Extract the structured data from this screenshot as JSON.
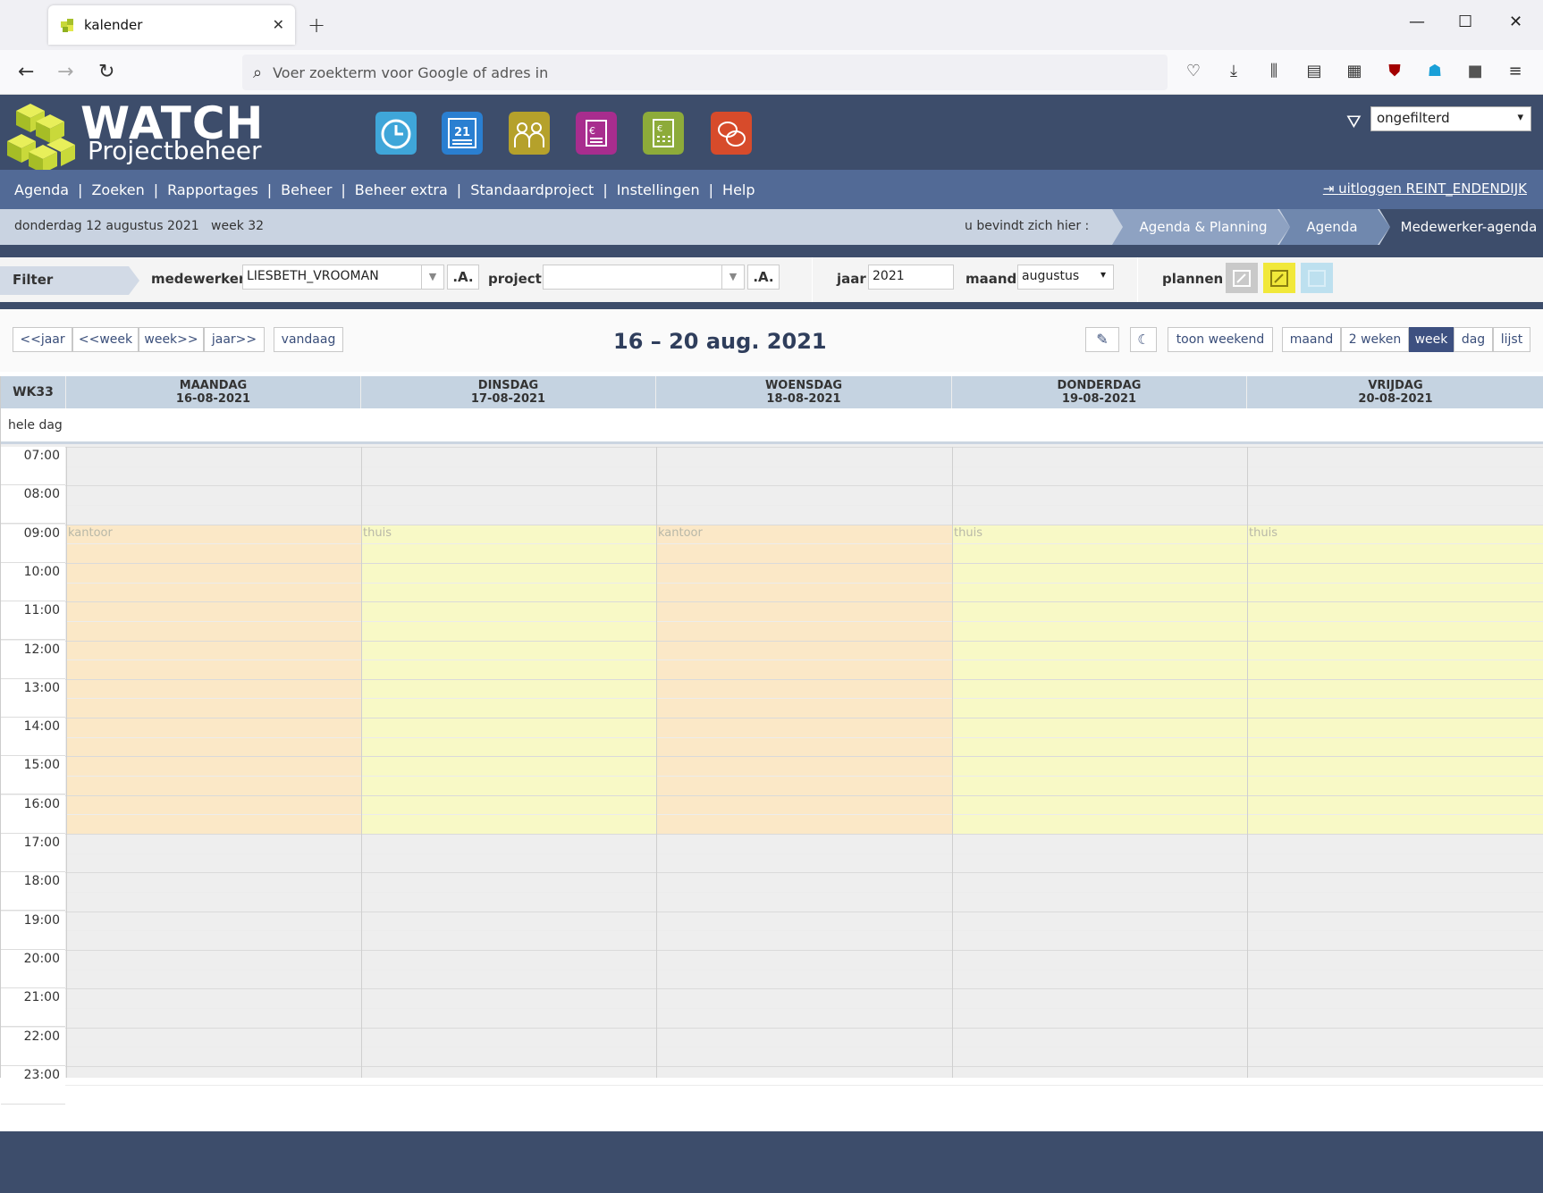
{
  "browser": {
    "tab_title": "kalender",
    "url_placeholder": "Voer zoekterm voor Google of adres in"
  },
  "app": {
    "logo_word": "WATCH",
    "logo_sub": "Projectbeheer",
    "filter_select": "ongefilterd",
    "menu": [
      "Agenda",
      "Zoeken",
      "Rapportages",
      "Beheer",
      "Beheer extra",
      "Standaardproject",
      "Instellingen",
      "Help"
    ],
    "logout": "uitloggen REINT_ENDENDIJK",
    "date": "donderdag 12 augustus 2021",
    "week": "week 32",
    "here_label": "u bevindt zich hier :",
    "crumbs": [
      "Agenda & Planning",
      "Agenda",
      "Medewerker-agenda"
    ]
  },
  "filter": {
    "label": "Filter",
    "employee_label": "medewerker",
    "employee_value": "LIESBETH_VROOMAN",
    "project_label": "project",
    "project_value": "",
    "a_btn": ".A.",
    "year_label": "jaar",
    "year_value": "2021",
    "month_label": "maand",
    "month_value": "augustus",
    "plan_label": "plannen"
  },
  "calnav": {
    "prev_year": "<<jaar",
    "prev_week": "<<week",
    "next_week": "week>>",
    "next_year": "jaar>>",
    "today": "vandaag",
    "title": "16 – 20 aug. 2021",
    "show_weekend": "toon weekend",
    "views": [
      "maand",
      "2 weken",
      "week",
      "dag",
      "lijst"
    ],
    "active_view": "week"
  },
  "calendar": {
    "week_label": "WK33",
    "all_day": "hele dag",
    "days": [
      {
        "name": "MAANDAG",
        "date": "16-08-2021",
        "location": "kantoor"
      },
      {
        "name": "DINSDAG",
        "date": "17-08-2021",
        "location": "thuis"
      },
      {
        "name": "WOENSDAG",
        "date": "18-08-2021",
        "location": "kantoor"
      },
      {
        "name": "DONDERDAG",
        "date": "19-08-2021",
        "location": "thuis"
      },
      {
        "name": "VRIJDAG",
        "date": "20-08-2021",
        "location": "thuis"
      }
    ],
    "hours": [
      "07:00",
      "08:00",
      "09:00",
      "10:00",
      "11:00",
      "12:00",
      "13:00",
      "14:00",
      "15:00",
      "16:00",
      "17:00",
      "18:00",
      "19:00",
      "20:00",
      "21:00",
      "22:00",
      "23:00"
    ],
    "colors": {
      "kantoor": "#fbe8c7",
      "thuis": "#f8f9c6"
    }
  }
}
